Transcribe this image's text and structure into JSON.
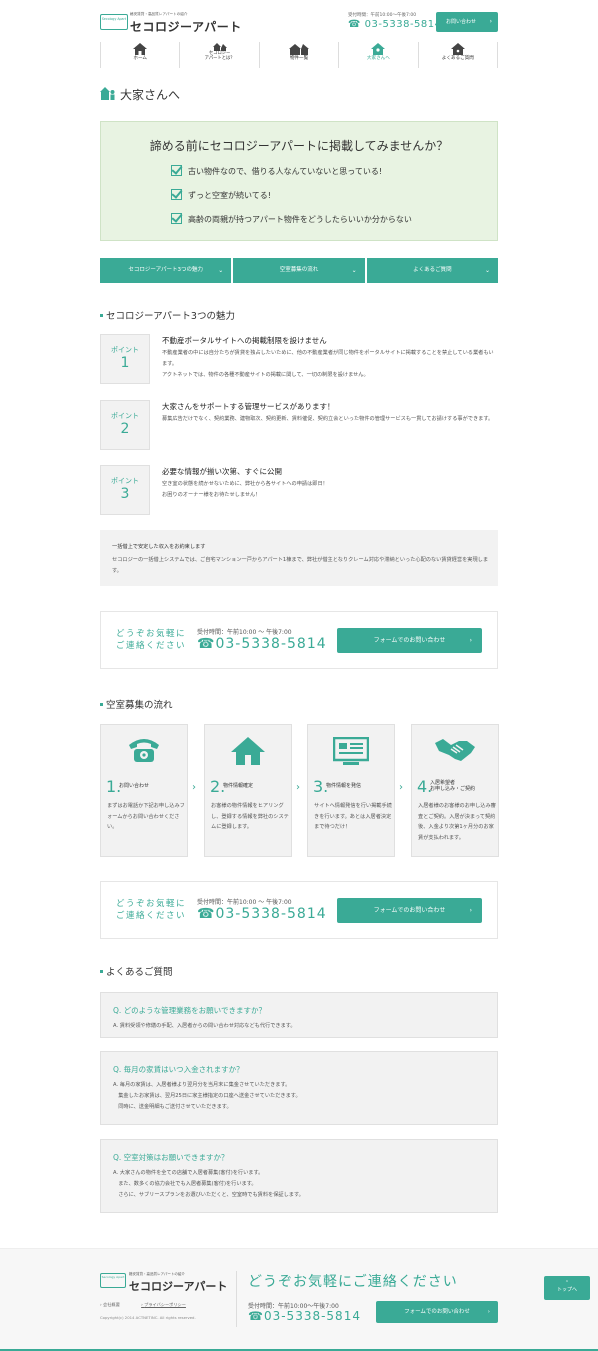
{
  "header": {
    "logo_badge": "Secology Apart",
    "logo_sub": "格安賃貸・高品質レアパートの紹介",
    "logo_main": "セコロジーアパート",
    "hours": "受付時間：午前10:00〜午後7:00",
    "tel": "03-5338-5814",
    "contact_button": "お問い合わせ"
  },
  "nav": [
    {
      "label": "ホーム"
    },
    {
      "label": "セコロジー\nアパートとは？"
    },
    {
      "label": "物件一覧"
    },
    {
      "label": "大家さんへ"
    },
    {
      "label": "よくあるご質問"
    }
  ],
  "page_title": "大家さんへ",
  "hero": {
    "title": "諦める前にセコロジーアパートに掲載してみませんか？",
    "checks": [
      "古い物件なので、借りる人なんていないと思っている!",
      "ずっと空室が続いてる!",
      "高齢の両親が持つアパート物件をどうしたらいいか分からない"
    ]
  },
  "tabs": [
    "セコロジーアパート3つの魅力",
    "空室募集の流れ",
    "よくあるご質問"
  ],
  "charm": {
    "heading": "セコロジーアパート3つの魅力",
    "points": [
      {
        "badge": "ポイント",
        "num": "1",
        "title": "不動産ポータルサイトへの掲載制限を設けません",
        "body": "不動産業者の中には自分たちが賃貸を独占したいために、他の不動産業者が同じ物件をポータルサイトに掲載することを禁止している業者もいます。\nアクトネットでは、物件の各種不動産サイトの掲載に関して、一切の制限を設けません。"
      },
      {
        "badge": "ポイント",
        "num": "2",
        "title": "大家さんをサポートする管理サービスがあります！",
        "body": "募集広告だけでなく、契約業務、建物取次、契約更新、賃料催促、契約立会といった物件の管理サービスも一貫してお請けする事ができます。"
      },
      {
        "badge": "ポイント",
        "num": "3",
        "title": "必要な情報が揃い次第、すぐに公開",
        "body": "空き室の状態を続かせないために、弊社から各サイトへの申請は即日！\nお困りのオーナー様をお待たせしません！"
      }
    ],
    "note_title": "一括借上で安定した収入をお約束します",
    "note_body": "セコロジーの一括借上システムでは、ご自宅マンション一戸からアパート1棟まで、弊社が借主となりクレーム対応や滞納といった心配のない賃貸経営を実現します。"
  },
  "cta": {
    "lead": "どうぞお気軽に\nご連絡ください",
    "hours": "受付時間：午前10:00 〜 午後7:00",
    "tel": "03-5338-5814",
    "button": "フォームでのお問い合わせ"
  },
  "flow": {
    "heading": "空室募集の流れ",
    "steps": [
      {
        "num": "1.",
        "title": "お問い合わせ",
        "text": "まずはお電話か下記お申し込みフォームからお問い合わせください。",
        "icon": "phone-icon"
      },
      {
        "num": "2.",
        "title": "物件情報確定",
        "text": "お客様の物件情報をヒアリングし、登録する情報を弊社のシステムに登録します。",
        "icon": "house-icon"
      },
      {
        "num": "3.",
        "title": "物件情報を発信",
        "text": "サイトへ情報発信を行い掲載手続きを行います。あとは入居者決定まで待つだけ！",
        "icon": "monitor-icon"
      },
      {
        "num": "4.",
        "title": "入居希望者\nお申し込み・ご契約",
        "text": "入居者様のお客様のお申し込み審査とご契約。入居が決まって契約後、入金より次第1ヶ月分のお家賃が支払われます。",
        "icon": "handshake-icon"
      }
    ]
  },
  "faq": {
    "heading": "よくあるご質問",
    "items": [
      {
        "q": "Q. どのような管理業務をお願いできますか？",
        "a": "A. 賃料受領や修繕の手配、入居者からの問い合わせ対応なども代行できます。"
      },
      {
        "q": "Q. 毎月の家賃はいつ入金されますか？",
        "a": "A. 毎月の家賃は、入居者様より翌月分を当月末に集金させていただきます。\n　集金したお家賃は、翌月25日に家主様指定の口座へ送金させていただきます。\n　同時に、送金明細もご送付させていただきます。"
      },
      {
        "q": "Q. 空室対策はお願いできますか？",
        "a": "A. 大家さんの物件を全ての店舗で入居者募集(客付)を行います。\n　また、数多くの協力会社でも入居者募集(客付)を行います。\n　さらに、サブリースプランをお選びいただくと、空室時でも賃料を保証します。"
      }
    ]
  },
  "footer": {
    "links": [
      "会社概要",
      "プライバシーポリシー"
    ],
    "copyright": "Copyright(c) 2014 ACTNETINC. All rights reserved.",
    "big": "どうぞお気軽にご連絡ください",
    "hours": "受付時間：午前10:00〜午後7:00",
    "tel": "03-5338-5814",
    "button": "フォームでのお問い合わせ",
    "to_top": "トップへ"
  },
  "colors": {
    "accent": "#3aaa96",
    "hero_bg": "#e8f3e2",
    "box_bg": "#f2f2f2"
  }
}
